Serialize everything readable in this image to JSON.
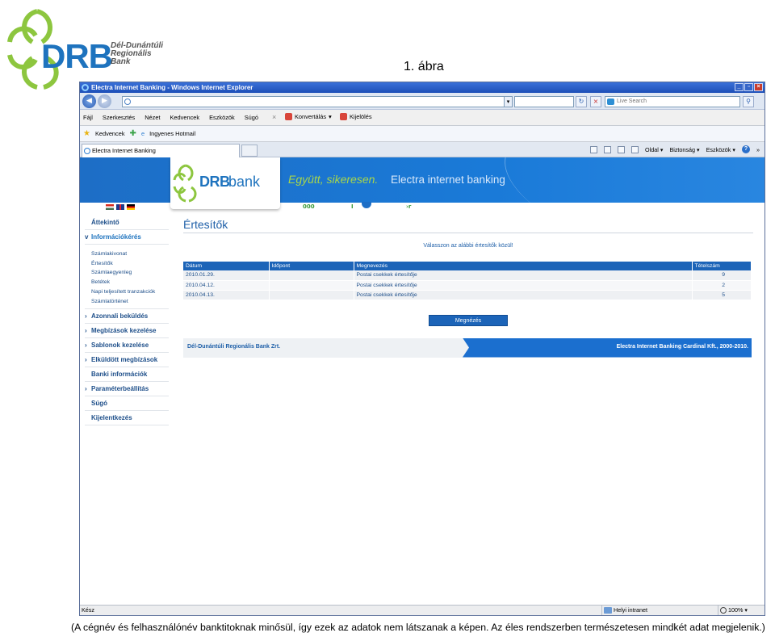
{
  "doc": {
    "logo_text": "DRB",
    "logo_bankname": [
      "Dél-Dunántúli",
      "Regionális",
      "Bank"
    ],
    "figure_label": "1. ábra",
    "caption": "(A cégnév és felhasználónév banktitoknak minősül, így ezek az adatok nem látszanak a képen. Az éles rendszerben természetesen mindkét adat megjelenik.)"
  },
  "window": {
    "title": "Electra Internet Banking - Windows Internet Explorer",
    "address_value": "",
    "search_placeholder": "Live Search",
    "menu": [
      "Fájl",
      "Szerkesztés",
      "Nézet",
      "Kedvencek",
      "Eszközök",
      "Súgó"
    ],
    "toolbar_convert": "Konvertálás",
    "toolbar_select": "Kijelölés",
    "favorites_label": "Kedvencek",
    "favorites_link": "Ingyenes Hotmail",
    "tab_title": "Electra Internet Banking",
    "cmd_page": "Oldal",
    "cmd_safety": "Biztonság",
    "cmd_tools": "Eszközök",
    "overflow": "»"
  },
  "banner": {
    "logo_drb": "DRB",
    "logo_bank": "bank",
    "slogan": "Együtt, sikeresen.",
    "product": "Electra internet banking",
    "strip_ooo": "000",
    "strip_i": "I",
    "strip_r": "›r"
  },
  "sidebar": {
    "items_top": [
      {
        "label": "Áttekintő",
        "chevron": ""
      },
      {
        "label": "Információkérés",
        "chevron": "v"
      }
    ],
    "subitems": [
      "Számlakivonat",
      "Értesítők",
      "Számlaegyenleg",
      "Betétek",
      "Napi teljesített tranzakciók",
      "Számlatörténet"
    ],
    "items_bottom": [
      {
        "label": "Azonnali beküldés",
        "chevron": "›"
      },
      {
        "label": "Megbízások kezelése",
        "chevron": "›"
      },
      {
        "label": "Sablonok kezelése",
        "chevron": "›"
      },
      {
        "label": "Elküldött megbízások",
        "chevron": "›"
      },
      {
        "label": "Banki információk",
        "chevron": ""
      },
      {
        "label": "Paraméterbeállítás",
        "chevron": "›"
      },
      {
        "label": "Súgó",
        "chevron": ""
      },
      {
        "label": "Kijelentkezés",
        "chevron": ""
      }
    ]
  },
  "main": {
    "title": "Értesítők",
    "instruction": "Válasszon az alábbi értesítők közül!",
    "table": {
      "headers": [
        "Dátum",
        "Időpont",
        "Megnevezés",
        "Tételszám"
      ],
      "rows": [
        [
          "2010.01.29.",
          "",
          "Postai csekkek értesítője",
          "9"
        ],
        [
          "2010.04.12.",
          "",
          "Postai csekkek értesítője",
          "2"
        ],
        [
          "2010.04.13.",
          "",
          "Postai csekkek értesítője",
          "5"
        ]
      ]
    },
    "view_button": "Megnézés",
    "footer_left": "Dél-Dunántúli Regionális Bank Zrt.",
    "footer_right": "Electra Internet Banking Cardinal Kft., 2000-2010."
  },
  "statusbar": {
    "status": "Kész",
    "zone": "Helyi intranet",
    "zoom": "100%"
  },
  "colors": {
    "brand_blue": "#1c64b8",
    "brand_green": "#8dc63f",
    "ie_title": "#2a5fc8"
  }
}
